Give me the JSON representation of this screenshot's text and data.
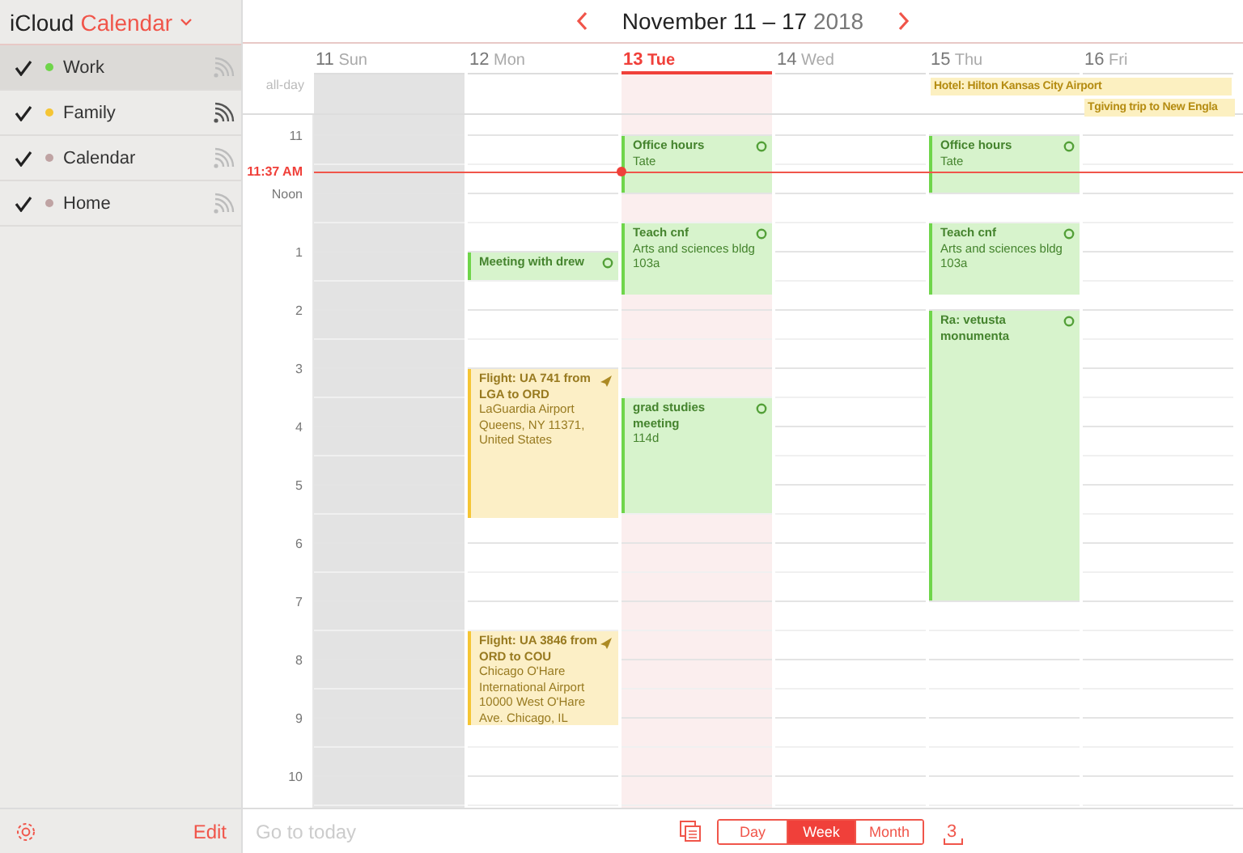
{
  "app": {
    "brand": "iCloud",
    "title": "Calendar"
  },
  "calendars": [
    {
      "name": "Work",
      "checked": true,
      "color": "#6fd54a",
      "selected": true,
      "shared": false
    },
    {
      "name": "Family",
      "checked": true,
      "color": "#f5c534",
      "selected": false,
      "shared": true
    },
    {
      "name": "Calendar",
      "checked": true,
      "color": "#bfa3a3",
      "selected": false,
      "shared": false
    },
    {
      "name": "Home",
      "checked": true,
      "color": "#bfa3a3",
      "selected": false,
      "shared": false
    }
  ],
  "sidebar_footer": {
    "edit": "Edit"
  },
  "header": {
    "range": "November 11 – 17",
    "year": "2018"
  },
  "all_day_label": "all-day",
  "hours": [
    "11",
    "Noon",
    "1",
    "2",
    "3",
    "4",
    "5",
    "6",
    "7",
    "8",
    "9",
    "10"
  ],
  "now": {
    "label": "11:37 AM"
  },
  "days": [
    {
      "number": "11",
      "name": "Sun",
      "today": false,
      "weekend": true
    },
    {
      "number": "12",
      "name": "Mon",
      "today": false,
      "weekend": false,
      "events": [
        {
          "kind": "meeting",
          "title": "Meeting with drew",
          "color": "#6fd54a"
        },
        {
          "kind": "flight",
          "title": "Flight: UA 741 from LGA to ORD",
          "details": [
            "LaGuardia Airport",
            "Queens, NY 11371,",
            "United States"
          ],
          "color": "#f5c534"
        },
        {
          "kind": "flight",
          "title": "Flight: UA 3846 from ORD to COU",
          "details": [
            "Chicago O'Hare",
            "International Airport",
            "10000 West O'Hare",
            "Ave. Chicago, IL"
          ],
          "color": "#f5c534"
        }
      ]
    },
    {
      "number": "13",
      "name": "Tue",
      "today": true,
      "weekend": false,
      "events": [
        {
          "kind": "meeting",
          "title": "Office hours",
          "details": [
            "Tate"
          ],
          "color": "#6fd54a"
        },
        {
          "kind": "meeting",
          "title": "Teach cnf",
          "details": [
            "Arts and sciences bldg",
            "103a"
          ],
          "color": "#6fd54a"
        },
        {
          "kind": "meeting",
          "title": "grad studies meeting",
          "details": [
            "114d"
          ],
          "color": "#6fd54a"
        }
      ]
    },
    {
      "number": "14",
      "name": "Wed",
      "today": false,
      "weekend": false
    },
    {
      "number": "15",
      "name": "Thu",
      "today": false,
      "weekend": false,
      "all_day": [
        {
          "title": "Hotel: Hilton Kansas City Airport",
          "color": "#fcf0c1"
        }
      ],
      "events": [
        {
          "kind": "meeting",
          "title": "Office hours",
          "details": [
            "Tate"
          ],
          "color": "#6fd54a"
        },
        {
          "kind": "meeting",
          "title": "Teach cnf",
          "details": [
            "Arts and sciences bldg",
            "103a"
          ],
          "color": "#6fd54a"
        },
        {
          "kind": "meeting",
          "title": "Ra: vetusta monumenta",
          "color": "#6fd54a"
        }
      ]
    },
    {
      "number": "16",
      "name": "Fri",
      "today": false,
      "weekend": false,
      "all_day": [
        {
          "title": "Tgiving trip to New Engla",
          "color": "#fcf0c1"
        }
      ]
    }
  ],
  "footer": {
    "today": {
      "label": "Go to today",
      "disabled": true
    },
    "views": [
      {
        "label": "Day",
        "selected": false
      },
      {
        "label": "Week",
        "selected": true
      },
      {
        "label": "Month",
        "selected": false
      }
    ],
    "inbox_count": "3"
  }
}
